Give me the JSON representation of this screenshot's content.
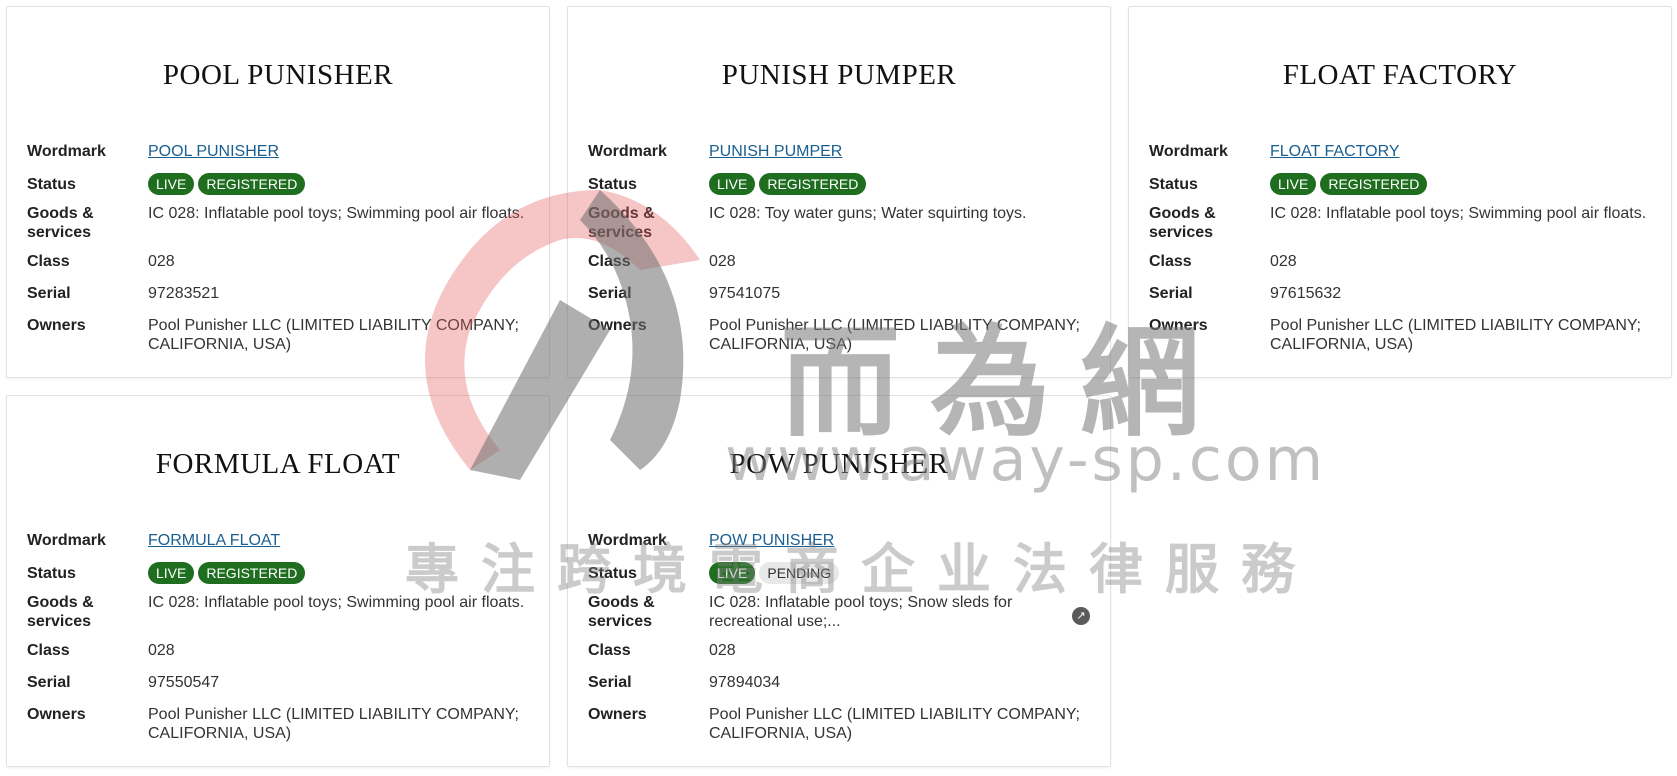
{
  "cards": [
    {
      "title": "POOL PUNISHER",
      "wordmark": "POOL PUNISHER",
      "statuses": [
        "LIVE",
        "REGISTERED"
      ],
      "goods_services": "IC 028: Inflatable pool toys; Swimming pool air floats.",
      "class": "028",
      "serial": "97283521",
      "owners": "Pool Punisher LLC (LIMITED LIABILITY COMPANY; CALIFORNIA, USA)"
    },
    {
      "title": "PUNISH PUMPER",
      "wordmark": "PUNISH PUMPER",
      "statuses": [
        "LIVE",
        "REGISTERED"
      ],
      "goods_services": "IC 028: Toy water guns; Water squirting toys.",
      "class": "028",
      "serial": "97541075",
      "owners": "Pool Punisher LLC (LIMITED LIABILITY COMPANY; CALIFORNIA, USA)"
    },
    {
      "title": "FLOAT FACTORY",
      "wordmark": "FLOAT FACTORY",
      "statuses": [
        "LIVE",
        "REGISTERED"
      ],
      "goods_services": "IC 028: Inflatable pool toys; Swimming pool air floats.",
      "class": "028",
      "serial": "97615632",
      "owners": "Pool Punisher LLC (LIMITED LIABILITY COMPANY; CALIFORNIA, USA)"
    },
    {
      "title": "FORMULA FLOAT",
      "wordmark": "FORMULA FLOAT",
      "statuses": [
        "LIVE",
        "REGISTERED"
      ],
      "goods_services": "IC 028: Inflatable pool toys; Swimming pool air floats.",
      "class": "028",
      "serial": "97550547",
      "owners": "Pool Punisher LLC (LIMITED LIABILITY COMPANY; CALIFORNIA, USA)"
    },
    {
      "title": "POW PUNISHER",
      "wordmark": "POW PUNISHER",
      "statuses": [
        "LIVE",
        "PENDING"
      ],
      "goods_services": "IC 028: Inflatable pool toys; Snow sleds for recreational use;...",
      "class": "028",
      "serial": "97894034",
      "owners": "Pool Punisher LLC (LIMITED LIABILITY COMPANY; CALIFORNIA, USA)"
    }
  ],
  "labels": {
    "wordmark": "Wordmark",
    "status": "Status",
    "goods_services": "Goods & services",
    "class": "Class",
    "serial": "Serial",
    "owners": "Owners"
  },
  "icons": {
    "expand": "expand-arrow-icon"
  },
  "colors": {
    "status_green": "#1f6e1f",
    "pending_gray": "#e8e8e8",
    "link_blue": "#1a5f91"
  },
  "watermark": {
    "cjk": "而為網",
    "url": "www.away-sp.com",
    "slogan": "專注跨境電商企业法律服務"
  }
}
